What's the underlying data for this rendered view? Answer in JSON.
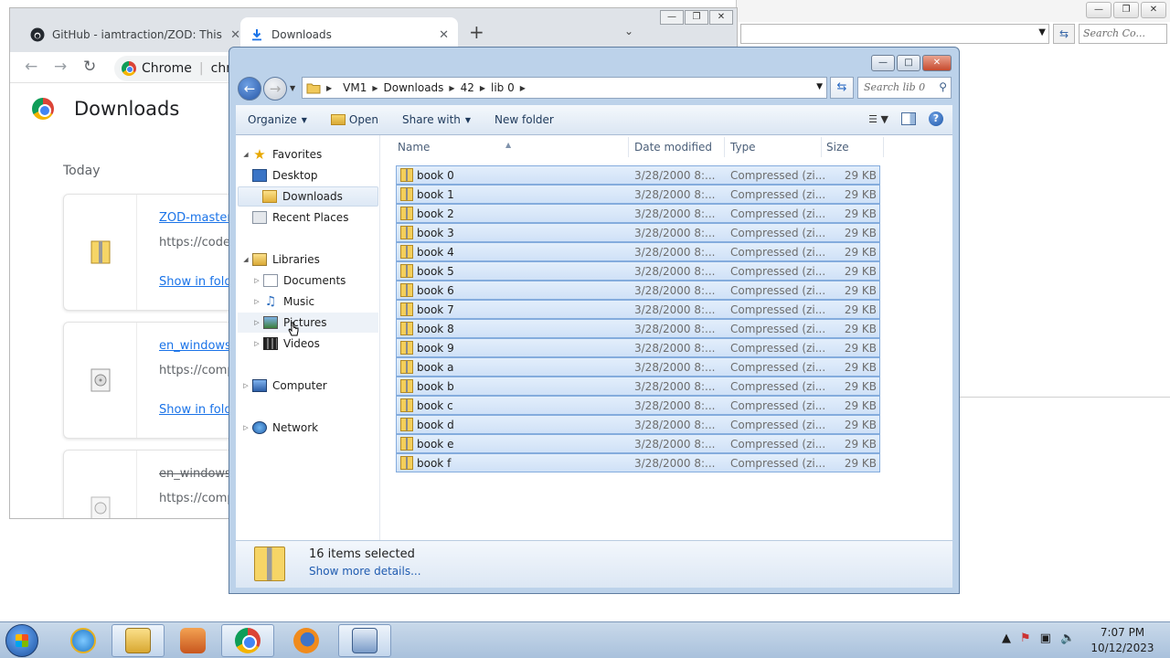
{
  "bg_explorer": {
    "search_placeholder": "Search Co..."
  },
  "chrome": {
    "tabs": [
      {
        "label": "GitHub - iamtraction/ZOD: This r"
      },
      {
        "label": "Downloads"
      }
    ],
    "omnibox": {
      "site_label": "Chrome",
      "url": "chro"
    },
    "page_title": "Downloads",
    "section": "Today",
    "downloads": [
      {
        "name": "ZOD-master.z",
        "url": "https://codel",
        "action": "Show in folde"
      },
      {
        "name": "en_windows_",
        "url": "https://comp",
        "action": "Show in folde"
      },
      {
        "name": "en_windows_",
        "url": "https://comp",
        "action": ""
      }
    ]
  },
  "explorer": {
    "breadcrumb": [
      "VM1",
      "Downloads",
      "42",
      "lib 0"
    ],
    "search_placeholder": "Search lib 0",
    "commands": {
      "organize": "Organize",
      "open": "Open",
      "share": "Share with",
      "new_folder": "New folder"
    },
    "nav": {
      "favorites": "Favorites",
      "desktop": "Desktop",
      "downloads": "Downloads",
      "recent": "Recent Places",
      "libraries": "Libraries",
      "documents": "Documents",
      "music": "Music",
      "pictures": "Pictures",
      "videos": "Videos",
      "computer": "Computer",
      "network": "Network"
    },
    "columns": {
      "name": "Name",
      "date": "Date modified",
      "type": "Type",
      "size": "Size"
    },
    "files": [
      {
        "name": "book 0",
        "date": "3/28/2000 8:...",
        "type": "Compressed (zi...",
        "size": "29 KB"
      },
      {
        "name": "book 1",
        "date": "3/28/2000 8:...",
        "type": "Compressed (zi...",
        "size": "29 KB"
      },
      {
        "name": "book 2",
        "date": "3/28/2000 8:...",
        "type": "Compressed (zi...",
        "size": "29 KB"
      },
      {
        "name": "book 3",
        "date": "3/28/2000 8:...",
        "type": "Compressed (zi...",
        "size": "29 KB"
      },
      {
        "name": "book 4",
        "date": "3/28/2000 8:...",
        "type": "Compressed (zi...",
        "size": "29 KB"
      },
      {
        "name": "book 5",
        "date": "3/28/2000 8:...",
        "type": "Compressed (zi...",
        "size": "29 KB"
      },
      {
        "name": "book 6",
        "date": "3/28/2000 8:...",
        "type": "Compressed (zi...",
        "size": "29 KB"
      },
      {
        "name": "book 7",
        "date": "3/28/2000 8:...",
        "type": "Compressed (zi...",
        "size": "29 KB"
      },
      {
        "name": "book 8",
        "date": "3/28/2000 8:...",
        "type": "Compressed (zi...",
        "size": "29 KB"
      },
      {
        "name": "book 9",
        "date": "3/28/2000 8:...",
        "type": "Compressed (zi...",
        "size": "29 KB"
      },
      {
        "name": "book a",
        "date": "3/28/2000 8:...",
        "type": "Compressed (zi...",
        "size": "29 KB"
      },
      {
        "name": "book b",
        "date": "3/28/2000 8:...",
        "type": "Compressed (zi...",
        "size": "29 KB"
      },
      {
        "name": "book c",
        "date": "3/28/2000 8:...",
        "type": "Compressed (zi...",
        "size": "29 KB"
      },
      {
        "name": "book d",
        "date": "3/28/2000 8:...",
        "type": "Compressed (zi...",
        "size": "29 KB"
      },
      {
        "name": "book e",
        "date": "3/28/2000 8:...",
        "type": "Compressed (zi...",
        "size": "29 KB"
      },
      {
        "name": "book f",
        "date": "3/28/2000 8:...",
        "type": "Compressed (zi...",
        "size": "29 KB"
      }
    ],
    "details": {
      "selected": "16 items selected",
      "more": "Show more details..."
    }
  },
  "taskbar": {
    "time": "7:07 PM",
    "date": "10/12/2023"
  }
}
